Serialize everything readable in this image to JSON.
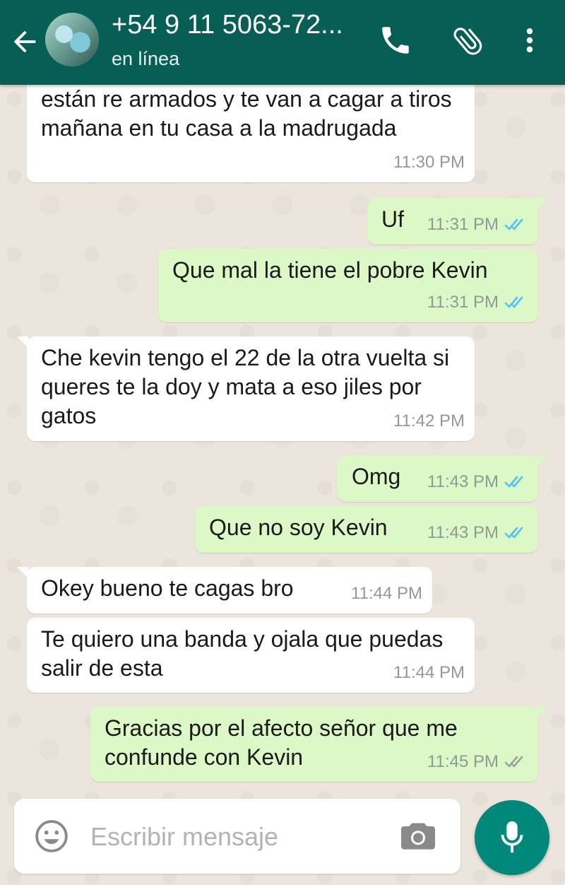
{
  "header": {
    "title": "+54 9 11 5063-72...",
    "status": "en línea",
    "color": "#075e54"
  },
  "icons": {
    "back": "arrow-left-icon",
    "avatar": "contact-avatar",
    "call": "phone-icon",
    "attach": "paperclip-icon",
    "menu": "more-vert-icon",
    "emoji": "emoji-icon",
    "camera": "camera-icon",
    "mic": "mic-icon",
    "read": "double-check-blue-icon",
    "delivered": "double-check-gray-icon"
  },
  "colors": {
    "incoming": "#ffffff",
    "outgoing": "#dcf8c6",
    "read_check": "#4fc3f7",
    "delivered_check": "#9aa39e",
    "mic_button": "#00897b"
  },
  "messages": [
    {
      "dir": "in",
      "text": "están re armados y te van a cagar a tiros mañana en tu casa a la madrugada",
      "time": "11:30 PM"
    },
    {
      "dir": "out",
      "text": "Uf",
      "time": "11:31 PM",
      "status": "read"
    },
    {
      "dir": "out",
      "text": "Que mal la tiene el pobre Kevin",
      "time": "11:31 PM",
      "status": "read"
    },
    {
      "dir": "in",
      "text": "Che kevin tengo el 22 de la otra vuelta si queres te la doy y mata a eso jiles por gatos",
      "time": "11:42 PM"
    },
    {
      "dir": "out",
      "text": "Omg",
      "time": "11:43 PM",
      "status": "read"
    },
    {
      "dir": "out",
      "text": "Que no soy Kevin",
      "time": "11:43 PM",
      "status": "read"
    },
    {
      "dir": "in",
      "text": "Okey bueno te cagas bro",
      "time": "11:44 PM"
    },
    {
      "dir": "in",
      "text": "Te quiero una banda y ojala que puedas salir de esta",
      "time": "11:44 PM"
    },
    {
      "dir": "out",
      "text": "Gracias por el afecto señor que me confunde con Kevin",
      "time": "11:45 PM",
      "status": "delivered"
    }
  ],
  "composer": {
    "placeholder": "Escribir mensaje",
    "value": ""
  }
}
